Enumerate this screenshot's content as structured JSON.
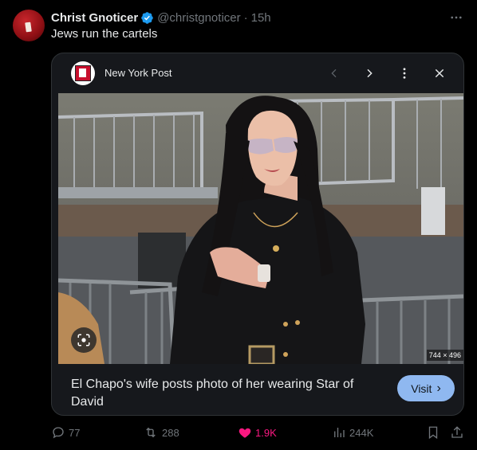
{
  "author": {
    "name": "Christ Gnoticer",
    "handle": "@christgnoticer",
    "separator": "·",
    "time": "15h"
  },
  "tweet": {
    "text": "Jews run the cartels"
  },
  "card": {
    "publisher": "New York Post",
    "image_dims": "744 × 496",
    "caption": "El Chapo's wife posts photo of her wearing Star of David",
    "visit_label": "Visit",
    "visit_chevron": "›"
  },
  "actions": {
    "replies": "77",
    "reposts": "288",
    "likes": "1.9K",
    "views": "244K"
  },
  "colors": {
    "verified": "#1d9bf0",
    "like": "#f91880",
    "visit_button": "#8fb8f0",
    "muted": "#71767b"
  },
  "icons": [
    "verified-badge-icon",
    "more-icon",
    "chevron-left-icon",
    "chevron-right-icon",
    "more-vertical-icon",
    "close-icon",
    "lens-icon",
    "reply-icon",
    "repost-icon",
    "heart-icon",
    "views-icon",
    "bookmark-icon",
    "share-icon"
  ]
}
